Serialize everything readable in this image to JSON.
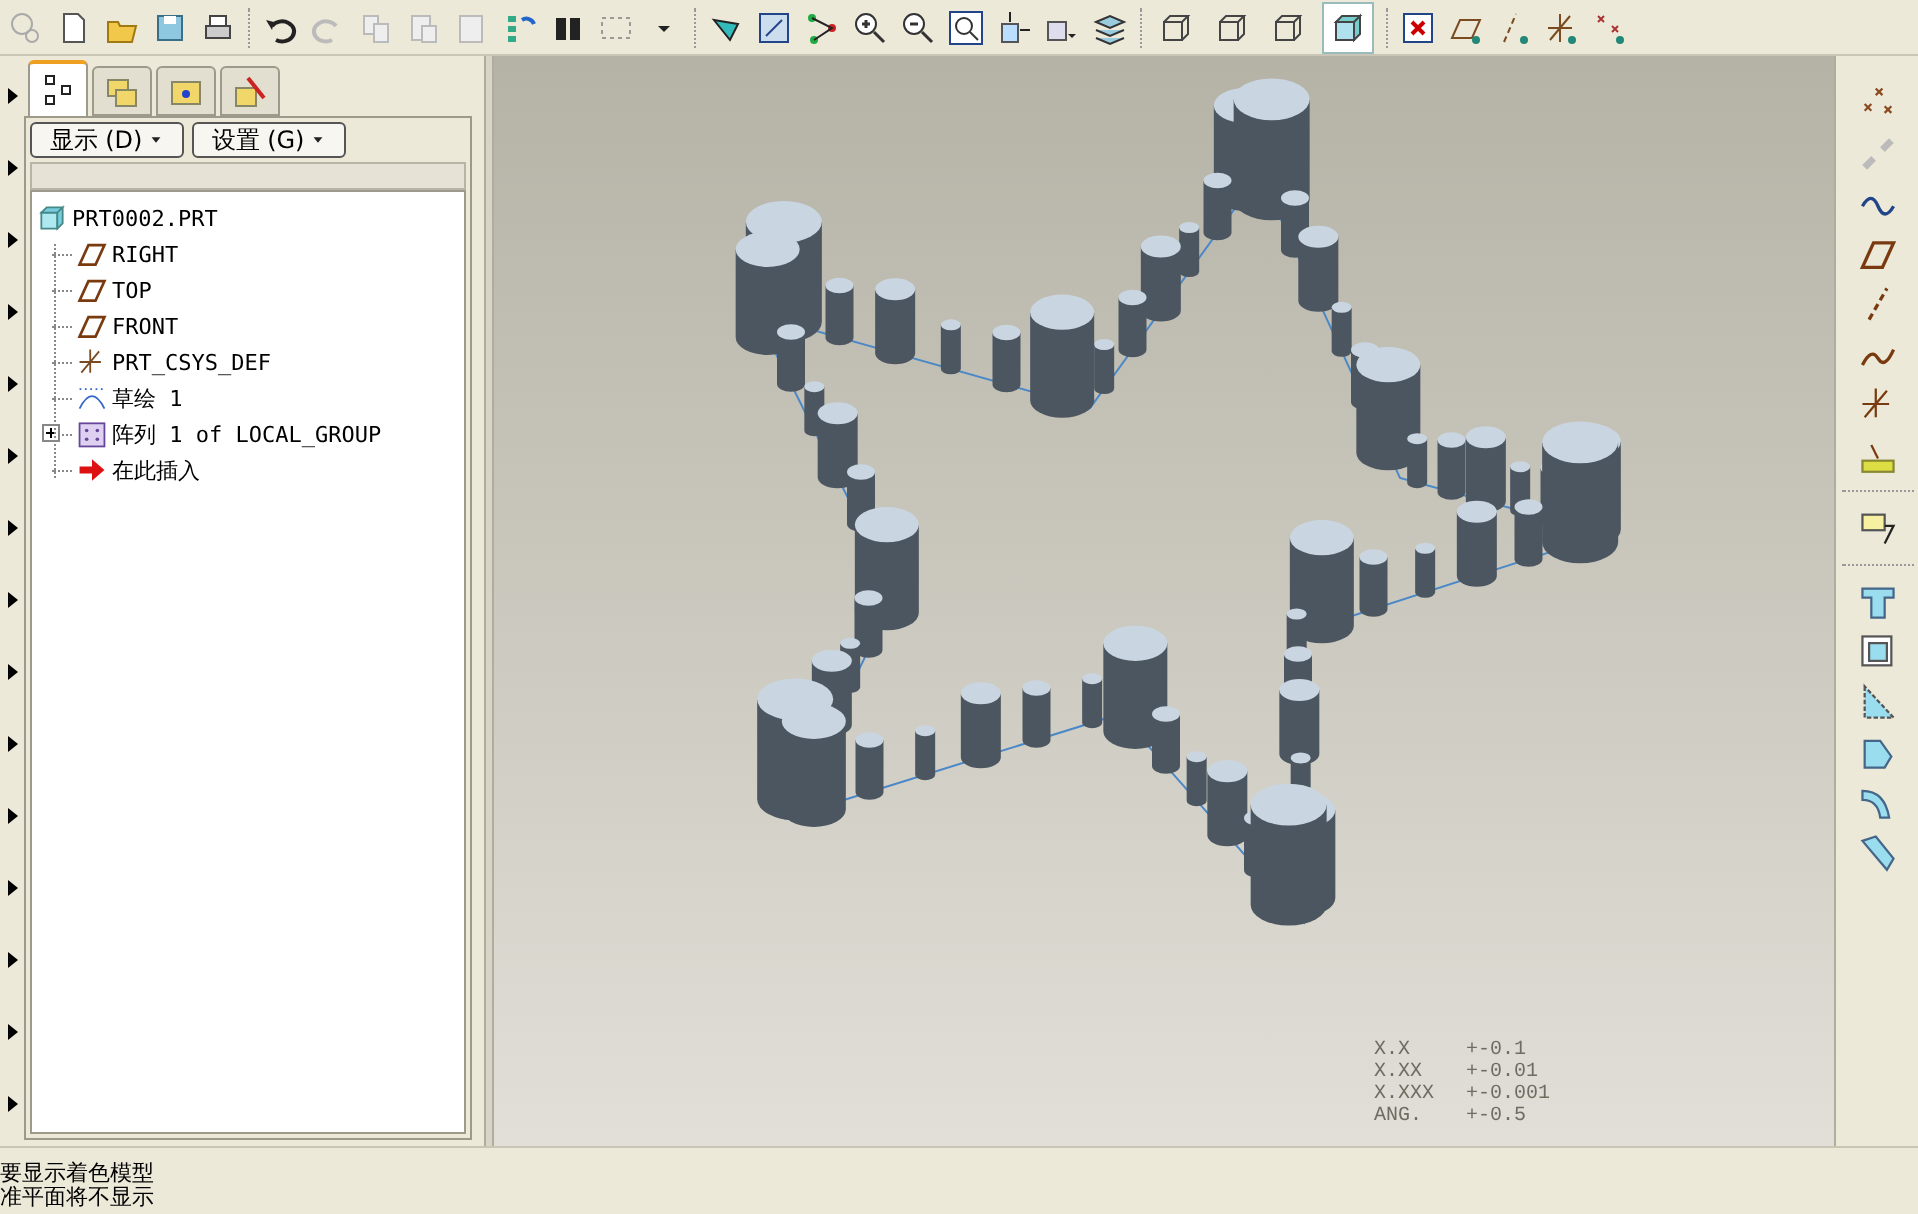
{
  "toolbar": {
    "display_style_buttons": [
      {
        "selected": false
      },
      {
        "selected": false
      },
      {
        "selected": false
      },
      {
        "selected": true
      }
    ]
  },
  "navigator": {
    "tabs": [
      {
        "selected": true
      },
      {
        "selected": false
      },
      {
        "selected": false
      },
      {
        "selected": false
      }
    ],
    "menus": [
      "显示 (D)",
      "设置 (G)"
    ],
    "tree": [
      {
        "label": "PRT0002.PRT",
        "kind": "part",
        "children": [
          {
            "label": "RIGHT",
            "kind": "plane"
          },
          {
            "label": "TOP",
            "kind": "plane"
          },
          {
            "label": "FRONT",
            "kind": "plane"
          },
          {
            "label": "PRT_CSYS_DEF",
            "kind": "csys"
          },
          {
            "label": "草绘 1",
            "kind": "sketch"
          },
          {
            "label": "阵列 1 of LOCAL_GROUP",
            "kind": "pattern",
            "expanded": false
          },
          {
            "label": "在此插入",
            "kind": "insert"
          }
        ]
      }
    ]
  },
  "viewport": {
    "tolerances": [
      [
        "X.X",
        "+-0.1"
      ],
      [
        "X.XX",
        "+-0.01"
      ],
      [
        "X.XXX",
        "+-0.001"
      ],
      [
        "ANG.",
        "+-0.5"
      ]
    ]
  },
  "status_bar": {
    "messages": [
      "要显示着色模型",
      "准平面将不显示"
    ]
  }
}
